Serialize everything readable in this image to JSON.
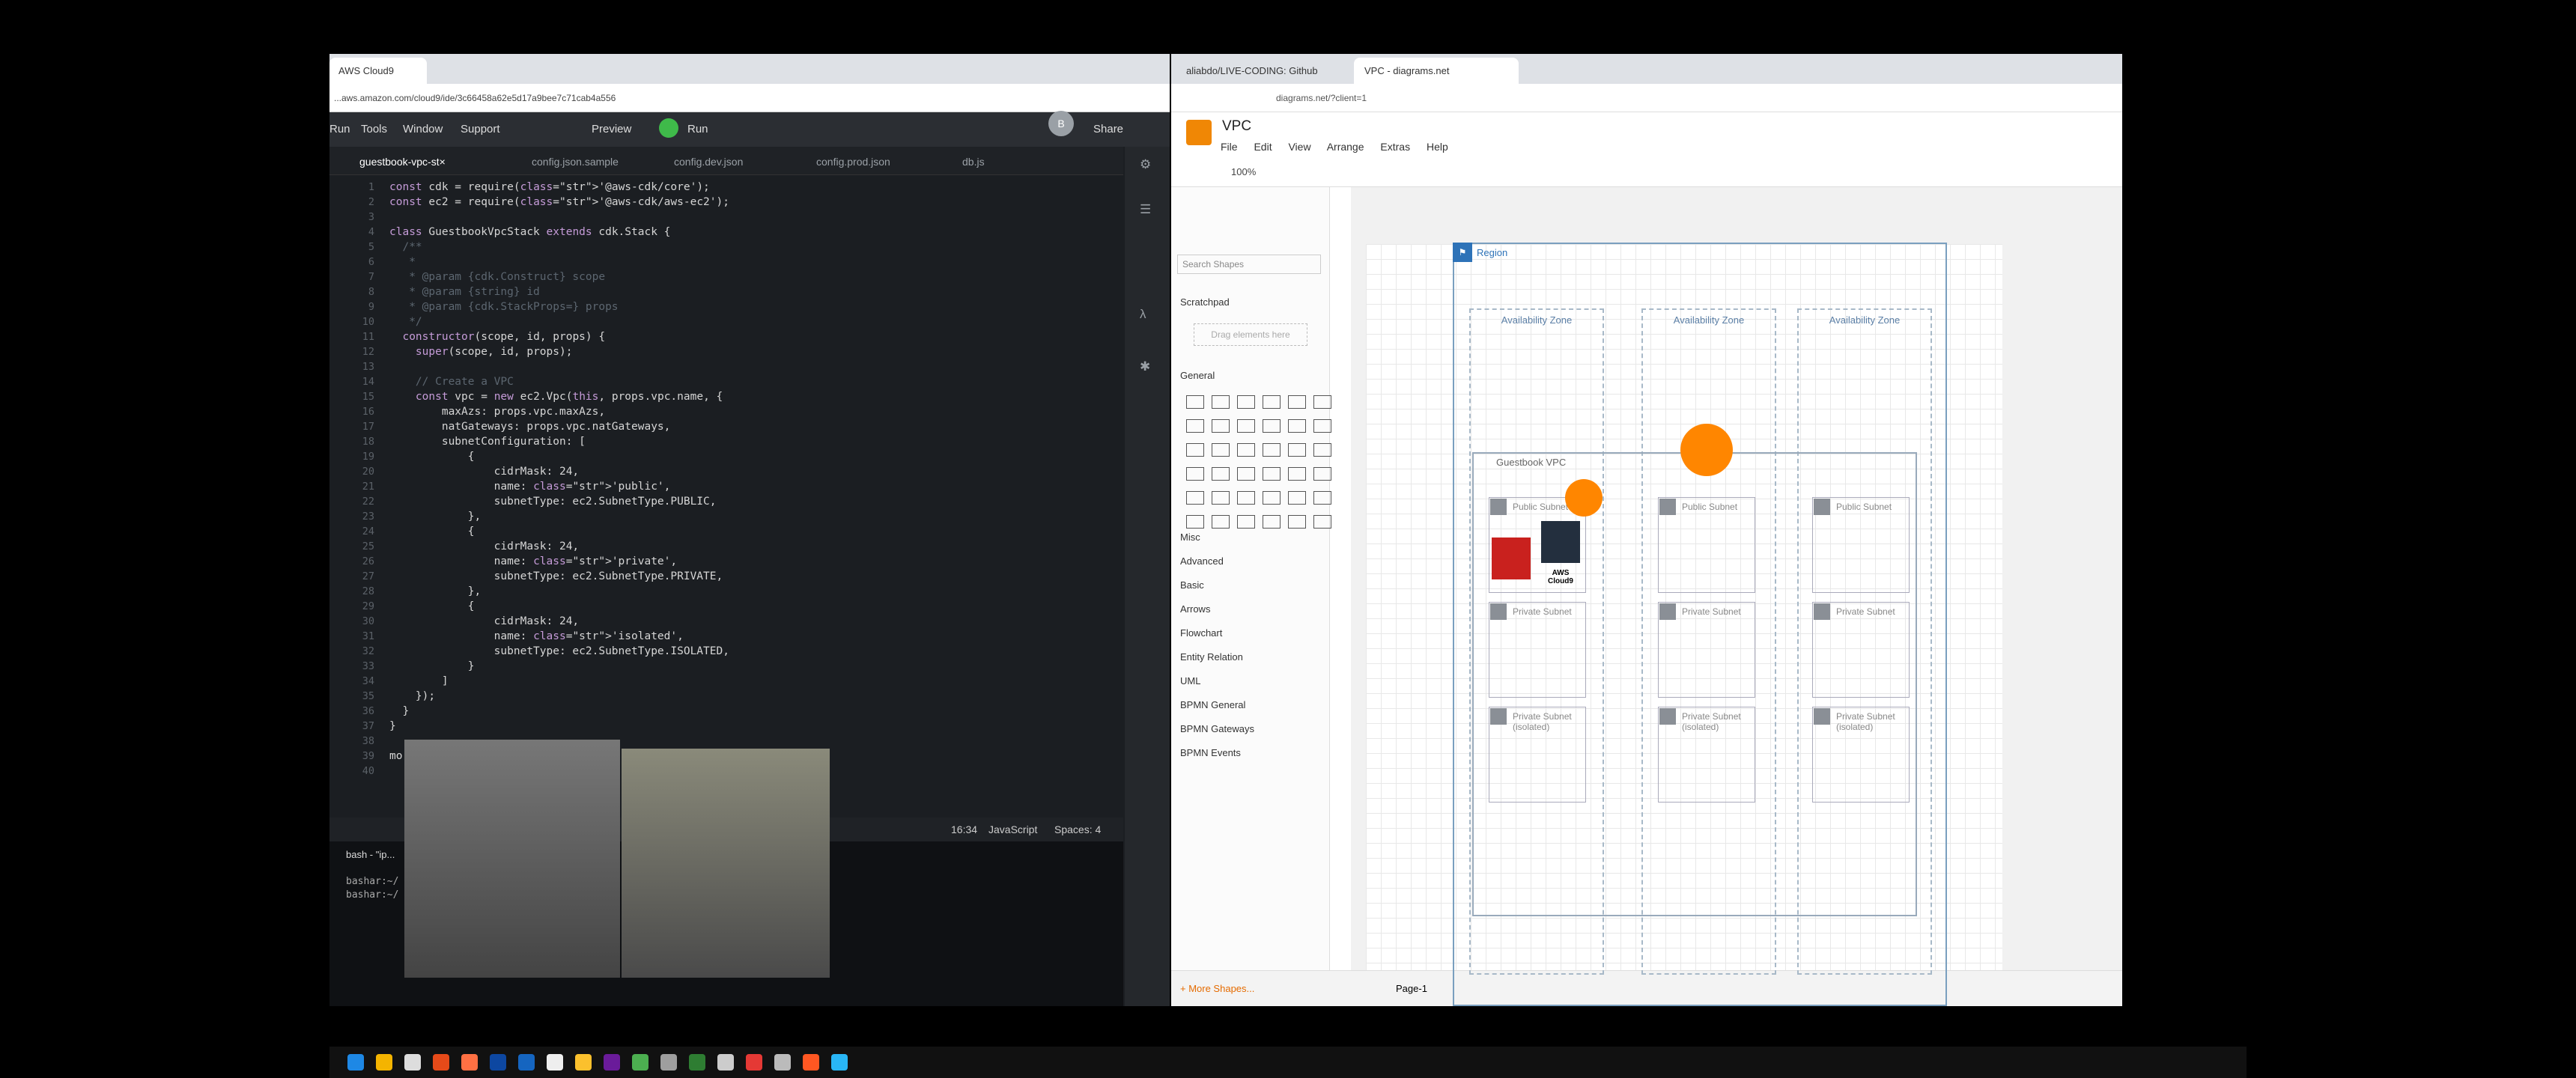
{
  "left_browser": {
    "tab_title": "AWS Cloud9",
    "url": "...aws.amazon.com/cloud9/ide/3c66458a62e5d17a9bee7c71cab4a556",
    "ide_menu": [
      "Run",
      "Tools",
      "Window",
      "Support",
      "Preview",
      "Run",
      "Share"
    ],
    "avatar_letter": "B",
    "editor_tabs": [
      "guestbook-vpc-st×",
      "config.json.sample",
      "config.dev.json",
      "config.prod.json",
      "db.js"
    ],
    "code_lines": [
      {
        "n": "1",
        "t": "const cdk = require('@aws-cdk/core');"
      },
      {
        "n": "2",
        "t": "const ec2 = require('@aws-cdk/aws-ec2');"
      },
      {
        "n": "3",
        "t": ""
      },
      {
        "n": "4",
        "t": "class GuestbookVpcStack extends cdk.Stack {"
      },
      {
        "n": "5",
        "t": "  /**"
      },
      {
        "n": "6",
        "t": "   *"
      },
      {
        "n": "7",
        "t": "   * @param {cdk.Construct} scope"
      },
      {
        "n": "8",
        "t": "   * @param {string} id"
      },
      {
        "n": "9",
        "t": "   * @param {cdk.StackProps=} props"
      },
      {
        "n": "10",
        "t": "   */"
      },
      {
        "n": "11",
        "t": "  constructor(scope, id, props) {"
      },
      {
        "n": "12",
        "t": "    super(scope, id, props);"
      },
      {
        "n": "13",
        "t": ""
      },
      {
        "n": "14",
        "t": "    // Create a VPC"
      },
      {
        "n": "15",
        "t": "    const vpc = new ec2.Vpc(this, props.vpc.name, {"
      },
      {
        "n": "16",
        "t": "        maxAzs: props.vpc.maxAzs,"
      },
      {
        "n": "17",
        "t": "        natGateways: props.vpc.natGateways,"
      },
      {
        "n": "18",
        "t": "        subnetConfiguration: ["
      },
      {
        "n": "19",
        "t": "            {"
      },
      {
        "n": "20",
        "t": "                cidrMask: 24,"
      },
      {
        "n": "21",
        "t": "                name: 'public',"
      },
      {
        "n": "22",
        "t": "                subnetType: ec2.SubnetType.PUBLIC,"
      },
      {
        "n": "23",
        "t": "            },"
      },
      {
        "n": "24",
        "t": "            {"
      },
      {
        "n": "25",
        "t": "                cidrMask: 24,"
      },
      {
        "n": "26",
        "t": "                name: 'private',"
      },
      {
        "n": "27",
        "t": "                subnetType: ec2.SubnetType.PRIVATE,"
      },
      {
        "n": "28",
        "t": "            },"
      },
      {
        "n": "29",
        "t": "            {"
      },
      {
        "n": "30",
        "t": "                cidrMask: 24,"
      },
      {
        "n": "31",
        "t": "                name: 'isolated',"
      },
      {
        "n": "32",
        "t": "                subnetType: ec2.SubnetType.ISOLATED,"
      },
      {
        "n": "33",
        "t": "            }"
      },
      {
        "n": "34",
        "t": "        ]"
      },
      {
        "n": "35",
        "t": "    });"
      },
      {
        "n": "36",
        "t": "  }"
      },
      {
        "n": "37",
        "t": "}"
      },
      {
        "n": "38",
        "t": ""
      },
      {
        "n": "39",
        "t": "mo                                    tack }"
      },
      {
        "n": "40",
        "t": ""
      }
    ],
    "status": {
      "cursor": "16:34",
      "language": "JavaScript",
      "spaces": "Spaces: 4"
    },
    "terminal_tab": "bash - \"ip...",
    "terminal_lines": [
      "bashar:~/                                  dk (master)",
      "bashar:~/                                  dk (master)"
    ]
  },
  "right_browser": {
    "tabs": [
      "aliabdo/LIVE-CODING: Github",
      "VPC - diagrams.net"
    ],
    "url": "diagrams.net/?client=1",
    "doc_title": "VPC",
    "menu": [
      "File",
      "Edit",
      "View",
      "Arrange",
      "Extras",
      "Help"
    ],
    "zoom": "100%",
    "search_placeholder": "Search Shapes",
    "scratchpad": "Scratchpad",
    "drag_hint": "Drag elements here",
    "sections": [
      "General",
      "Misc",
      "Advanced",
      "Basic",
      "Arrows",
      "Flowchart",
      "Entity Relation",
      "UML",
      "BPMN General",
      "BPMN Gateways",
      "BPMN Events"
    ],
    "more_shapes": "+ More Shapes...",
    "page_tab": "Page-1",
    "diagram": {
      "region": "Region",
      "az": "Availability Zone",
      "vpc": "Guestbook VPC",
      "public_subnet": "Public Subnet",
      "private_subnet": "Private Subnet",
      "isolated_subnet": "Private Subnet (isolated)",
      "cloud9_label": "AWS Cloud9"
    }
  }
}
